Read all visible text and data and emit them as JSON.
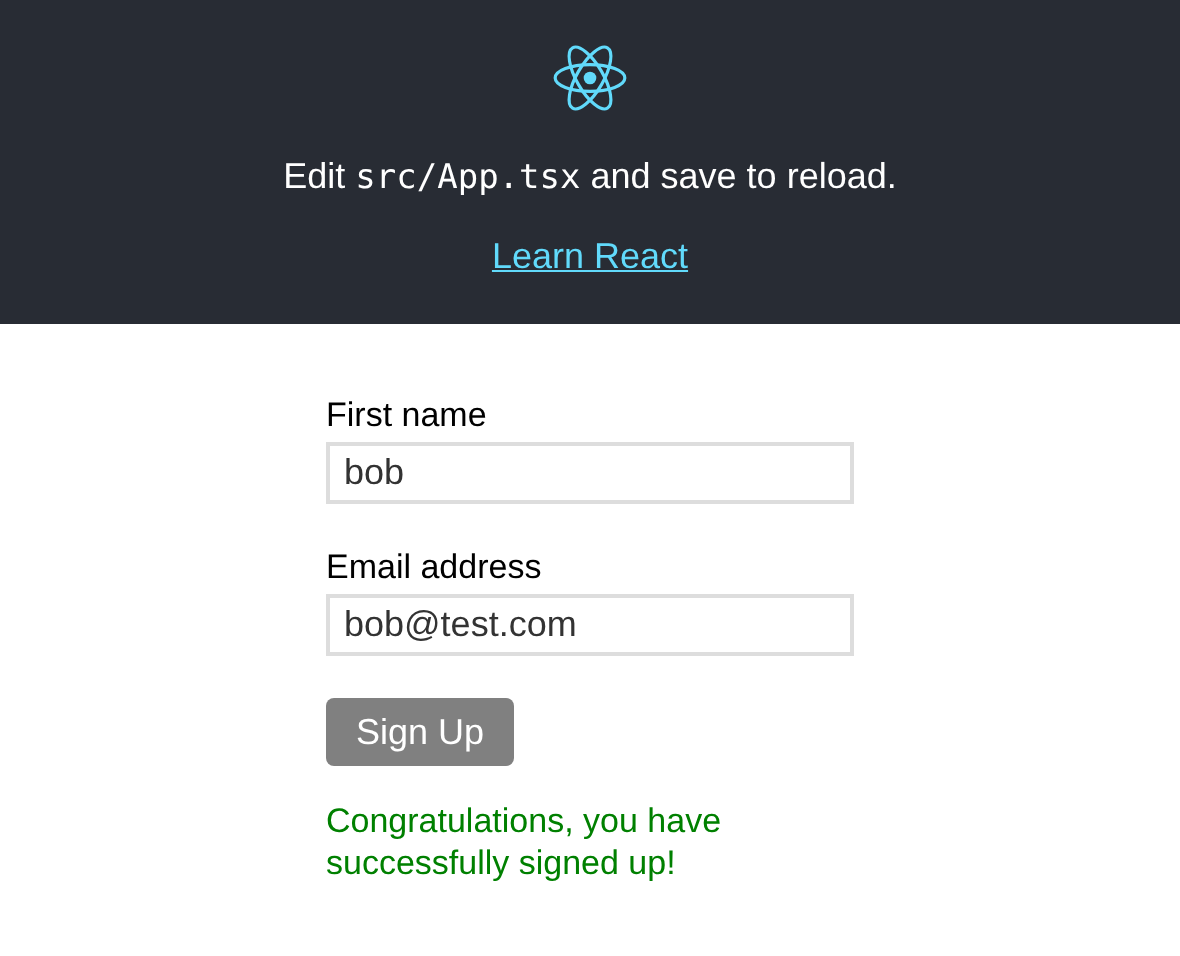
{
  "header": {
    "intro": [
      {
        "kind": "text",
        "text": "Edit "
      },
      {
        "kind": "code",
        "text": "src/App.tsx"
      },
      {
        "kind": "text",
        "text": " and save to reload."
      }
    ],
    "link": "Learn React"
  },
  "form": {
    "fields": [
      {
        "label": "First name",
        "value": "bob"
      },
      {
        "label": "Email address",
        "value": "bob@test.com"
      }
    ],
    "button": "Sign Up",
    "message": "Congratulations, you have successfully signed up!"
  }
}
